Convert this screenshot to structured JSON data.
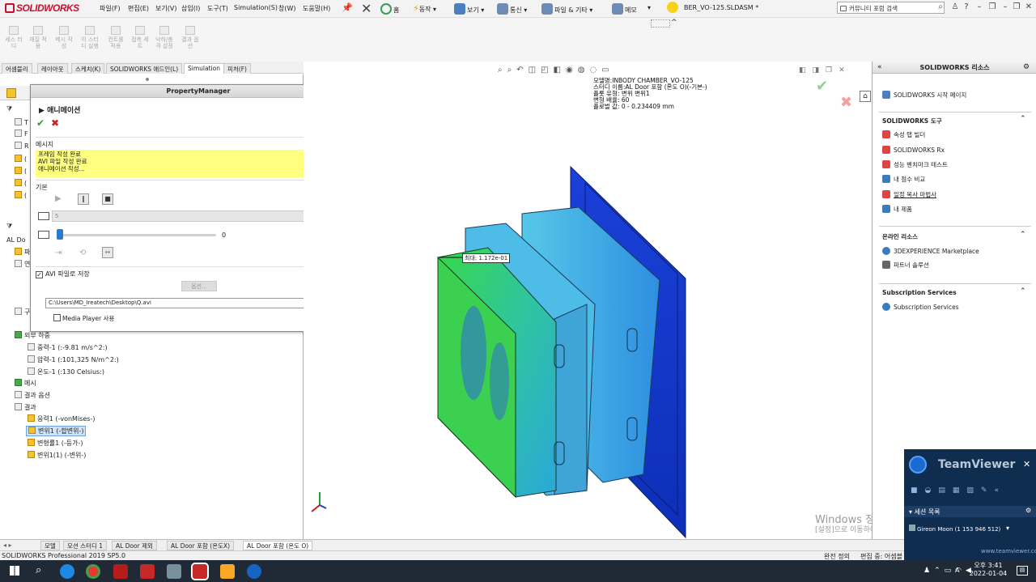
{
  "app": {
    "brand": "SOLIDWORKS",
    "filename": "BER_VO-125.SLDASM *"
  },
  "menu": [
    "파일(F)",
    "편집(E)",
    "보기(V)",
    "삽입(I)",
    "도구(T)",
    "Simulation(S)",
    "창(W)",
    "도움말(H)"
  ],
  "toolbar": {
    "home": "홈",
    "motion": "동작",
    "view": "보기",
    "comm": "통신",
    "file_more": "파일 & 기타",
    "memo": "메모"
  },
  "search": {
    "placeholder": "커뮤니티 포럼 검색"
  },
  "commands": [
    "세스 터 디",
    "재질 적 용",
    "메시 작 성",
    "이 스터 디 실행",
    "컨트롤 적용",
    "접촉 세 트",
    "낙하/충 격 설정",
    "결과 옵 션"
  ],
  "tabs": [
    "어셈블리",
    "레이아웃",
    "스케치(K)",
    "SOLIDWORKS 애드인(L)",
    "Simulation",
    "피처(F)"
  ],
  "tree": {
    "partial": [
      "T",
      "F",
      "R",
      "(",
      "(",
      "(",
      "(",
      "AL Do",
      "파",
      "연",
      "구"
    ],
    "external_loads": "외부 하중",
    "loads": [
      "중력-1 (:-9.81 m/s^2:)",
      "압력-1 (:101,325 N/m^2:)",
      "온도-1 (:130 Celsius:)"
    ],
    "mesh": "메시",
    "result_options": "결과 옵션",
    "results": "결과",
    "result_items": [
      "응력1 (-vonMises-)",
      "변위1 (-합변위-)",
      "변형률1 (-등가-)",
      "변위1(1) (-변위-)"
    ]
  },
  "pm": {
    "title": "PropertyManager",
    "feature": "애니메이션",
    "message_title": "메시지",
    "messages": [
      "프레임 작성 완료",
      "AVI 파일 작성 완료",
      "애니메이션 작성..."
    ],
    "basic_title": "기본",
    "frames_value": "5",
    "slider_value": "0",
    "slider_fraction": 0,
    "avi_title": "AVI 파일로 저장",
    "options_label": "옵션...",
    "path": "C:\\Users\\MD_Ireatech\\Desktop\\Q.avi",
    "browse": "...",
    "media_player": "Media Player 사용"
  },
  "hud": {
    "lines": [
      "모델명:INBODY CHAMBER_VO-125",
      "스터디 이름:AL Door 포함 (온도 O)(-기본-)",
      "플롯 유형: 변위 변위1",
      "변형 배율: 60",
      "플로벌 값: 0 - 0.234409 mm"
    ],
    "max_label": "최대: 1.172e-01"
  },
  "right": {
    "title": "SOLIDWORKS 리소스",
    "start": "SOLIDWORKS 시작 페이지",
    "tools_title": "SOLIDWORKS 도구",
    "tools": [
      "속성 탭 빌더",
      "SOLIDWORKS Rx",
      "성능 벤치마크 테스트",
      "내 점수 비교",
      "일정 복사 마법사",
      "내 제품"
    ],
    "online_title": "온라인 리소스",
    "online": [
      "3DEXPERIENCE Marketplace",
      "파트너 솔루션"
    ],
    "sub_title": "Subscription Services",
    "sub": [
      "Subscription Services"
    ]
  },
  "bottom_tabs": [
    "모델",
    "모션 스터디 1",
    "AL Door 제외",
    "AL Door 포함 (온도X)",
    "AL Door 포함 (온도 O)"
  ],
  "status": {
    "product": "SOLIDWORKS Professional 2019 SP5.0",
    "state": "완전 정의",
    "editing": "편집 중: 어셈블"
  },
  "watermark": {
    "line1": "Windows 정품",
    "line2": "[설정]으로 이동하여 Windows를 정품 인증합니다."
  },
  "teamviewer": {
    "name": "TeamViewer",
    "session_list": "세션 목록",
    "session": "Gireon Moon (1 153 946 512)",
    "url": "www.teamviewer.com"
  },
  "clock": {
    "time": "오후 3:41",
    "date": "2022-01-04",
    "lang": "A"
  }
}
